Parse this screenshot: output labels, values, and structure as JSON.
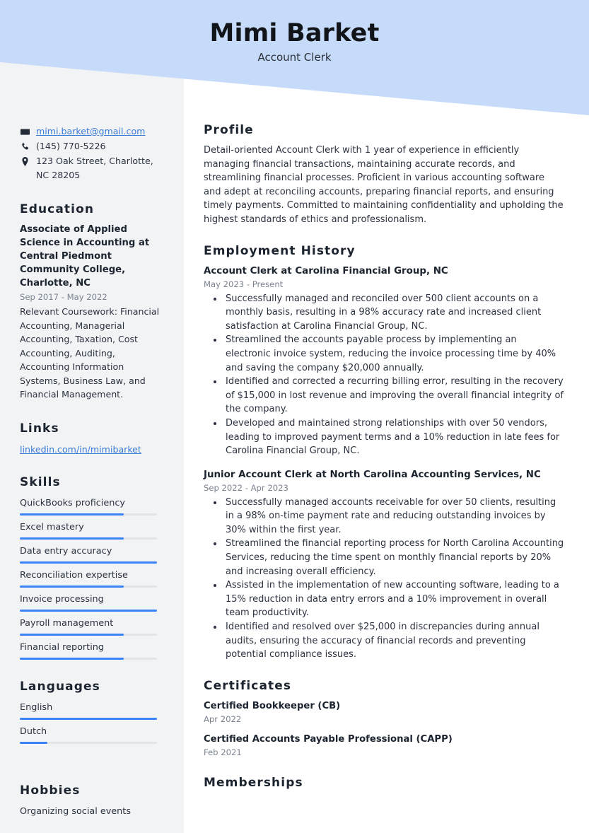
{
  "header": {
    "name": "Mimi Barket",
    "job_title": "Account Clerk",
    "band_color": "#c5dbf9",
    "sidebar_color": "#f2f3f5"
  },
  "sidebar": {
    "contact": {
      "email": "mimi.barket@gmail.com",
      "phone": "(145) 770-5226",
      "address": "123 Oak Street, Charlotte, NC 28205",
      "email_icon": "envelope-icon",
      "phone_icon": "phone-icon",
      "address_icon": "map-pin-icon"
    },
    "education": {
      "heading": "Education",
      "entries": [
        {
          "title": "Associate of Applied Science in Accounting at Central Piedmont Community College, Charlotte, NC",
          "date": "Sep 2017 - May 2022",
          "description": "Relevant Coursework: Financial Accounting, Managerial Accounting, Taxation, Cost Accounting, Auditing, Accounting Information Systems, Business Law, and Financial Management."
        }
      ]
    },
    "links": {
      "heading": "Links",
      "items": [
        {
          "label": "linkedin.com/in/mimibarket"
        }
      ]
    },
    "skills": {
      "heading": "Skills",
      "items": [
        {
          "label": "QuickBooks proficiency",
          "level": 76
        },
        {
          "label": "Excel mastery",
          "level": 76
        },
        {
          "label": "Data entry accuracy",
          "level": 100
        },
        {
          "label": "Reconciliation expertise",
          "level": 76
        },
        {
          "label": "Invoice processing",
          "level": 100
        },
        {
          "label": "Payroll management",
          "level": 76
        },
        {
          "label": "Financial reporting",
          "level": 76
        }
      ]
    },
    "languages": {
      "heading": "Languages",
      "items": [
        {
          "label": "English",
          "level": 100
        },
        {
          "label": "Dutch",
          "level": 20
        }
      ]
    },
    "hobbies": {
      "heading": "Hobbies",
      "items": [
        {
          "label": "Organizing social events"
        }
      ]
    },
    "accent_color": "#3b82f6",
    "track_color": "#e2e4e8",
    "link_color": "#3a7bd5"
  },
  "main": {
    "profile": {
      "heading": "Profile",
      "text": "Detail-oriented Account Clerk with 1 year of experience in efficiently managing financial transactions, maintaining accurate records, and streamlining financial processes. Proficient in various accounting software and adept at reconciling accounts, preparing financial reports, and ensuring timely payments. Committed to maintaining confidentiality and upholding the highest standards of ethics and professionalism."
    },
    "employment": {
      "heading": "Employment History",
      "jobs": [
        {
          "title": "Account Clerk at Carolina Financial Group, NC",
          "date": "May 2023 - Present",
          "bullets": [
            "Successfully managed and reconciled over 500 client accounts on a monthly basis, resulting in a 98% accuracy rate and increased client satisfaction at Carolina Financial Group, NC.",
            "Streamlined the accounts payable process by implementing an electronic invoice system, reducing the invoice processing time by 40% and saving the company $20,000 annually.",
            "Identified and corrected a recurring billing error, resulting in the recovery of $15,000 in lost revenue and improving the overall financial integrity of the company.",
            "Developed and maintained strong relationships with over 50 vendors, leading to improved payment terms and a 10% reduction in late fees for Carolina Financial Group, NC."
          ]
        },
        {
          "title": "Junior Account Clerk at North Carolina Accounting Services, NC",
          "date": "Sep 2022 - Apr 2023",
          "bullets": [
            "Successfully managed accounts receivable for over 50 clients, resulting in a 98% on-time payment rate and reducing outstanding invoices by 30% within the first year.",
            "Streamlined the financial reporting process for North Carolina Accounting Services, reducing the time spent on monthly financial reports by 20% and increasing overall efficiency.",
            "Assisted in the implementation of new accounting software, leading to a 15% reduction in data entry errors and a 10% improvement in overall team productivity.",
            "Identified and resolved over $25,000 in discrepancies during annual audits, ensuring the accuracy of financial records and preventing potential compliance issues."
          ]
        }
      ]
    },
    "certificates": {
      "heading": "Certificates",
      "items": [
        {
          "title": "Certified Bookkeeper (CB)",
          "date": "Apr 2022"
        },
        {
          "title": "Certified Accounts Payable Professional (CAPP)",
          "date": "Feb 2021"
        }
      ]
    },
    "memberships": {
      "heading": "Memberships"
    }
  }
}
